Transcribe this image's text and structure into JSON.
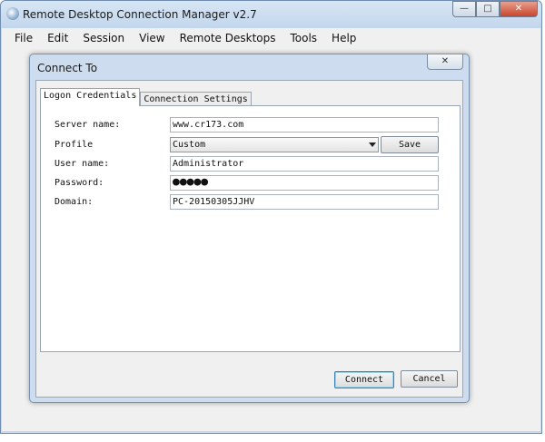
{
  "app": {
    "title": "Remote Desktop Connection Manager v2.7",
    "icon": "rdcman-app-icon",
    "window_buttons": {
      "minimize": "—",
      "maximize": "□",
      "close": "✕"
    }
  },
  "menu": {
    "items": [
      "File",
      "Edit",
      "Session",
      "View",
      "Remote Desktops",
      "Tools",
      "Help"
    ]
  },
  "dialog": {
    "title": "Connect To",
    "close_glyph": "✕",
    "tabs": [
      {
        "label": "Logon Credentials",
        "active": true
      },
      {
        "label": "Connection Settings",
        "active": false
      }
    ],
    "fields": {
      "server_name": {
        "label": "Server name:",
        "value": "www.cr173.com"
      },
      "profile": {
        "label": "Profile",
        "value": "Custom",
        "save_label": "Save"
      },
      "user_name": {
        "label": "User name:",
        "value": "Administrator"
      },
      "password": {
        "label": "Password:",
        "value": "●●●●●"
      },
      "domain": {
        "label": "Domain:",
        "value": "PC-20150305JJHV"
      }
    },
    "buttons": {
      "connect": "Connect",
      "cancel": "Cancel"
    }
  },
  "colors": {
    "frame": "#c9dbee",
    "client": "#f0f0f0",
    "close_button": "#c8452c",
    "default_button_border": "#3c7fb1"
  }
}
